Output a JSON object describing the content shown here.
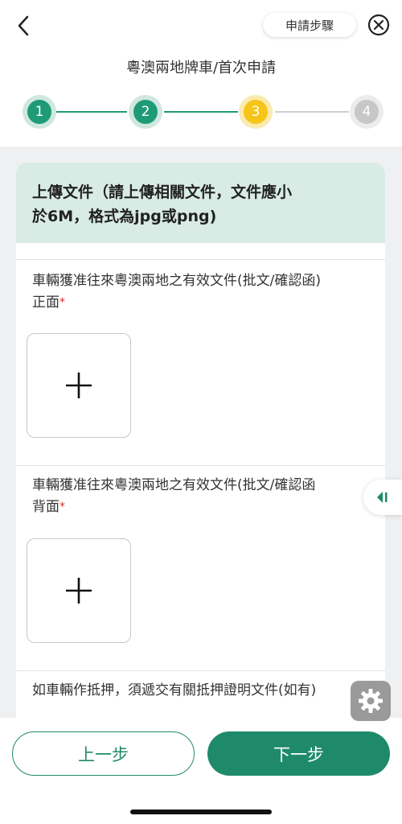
{
  "header": {
    "steps_link_label": "申請步驟",
    "title": "粵澳兩地牌車/首次申請"
  },
  "stepper": {
    "steps": [
      {
        "number": "1",
        "state": "done"
      },
      {
        "number": "2",
        "state": "done"
      },
      {
        "number": "3",
        "state": "current"
      },
      {
        "number": "4",
        "state": "pending"
      }
    ]
  },
  "card": {
    "header_line1": "上傳文件（請上傳相關文件，文件應小",
    "header_line2": "於6M，格式為jpg或png)",
    "fields": [
      {
        "label_line1": "車輛獲准往來粵澳兩地之有效文件(批文/確認函)",
        "label_line2": "正面",
        "required_mark": "*"
      },
      {
        "label_line1": "車輛獲准往來粵澳兩地之有效文件(批文/確認函",
        "label_line2": "背面",
        "required_mark": "*"
      },
      {
        "label_line1": "如車輛作抵押，須遞交有關抵押證明文件(如有)"
      }
    ],
    "upload_plus": "+"
  },
  "footer": {
    "prev_label": "上一步",
    "next_label": "下一步"
  },
  "colors": {
    "brand_green": "#1f8a6a",
    "step_done": "#1f9a77",
    "step_current": "#f5c518",
    "step_pending": "#c7c7c7",
    "card_header_bg": "#d8ebe5",
    "page_bg": "#eef0f2",
    "required": "#d32f2f"
  },
  "icons": {
    "back": "chevron-left-icon",
    "close": "close-circle-icon",
    "side_tab": "collapse-arrow-icon",
    "settings": "gear-icon",
    "upload": "plus-icon"
  }
}
